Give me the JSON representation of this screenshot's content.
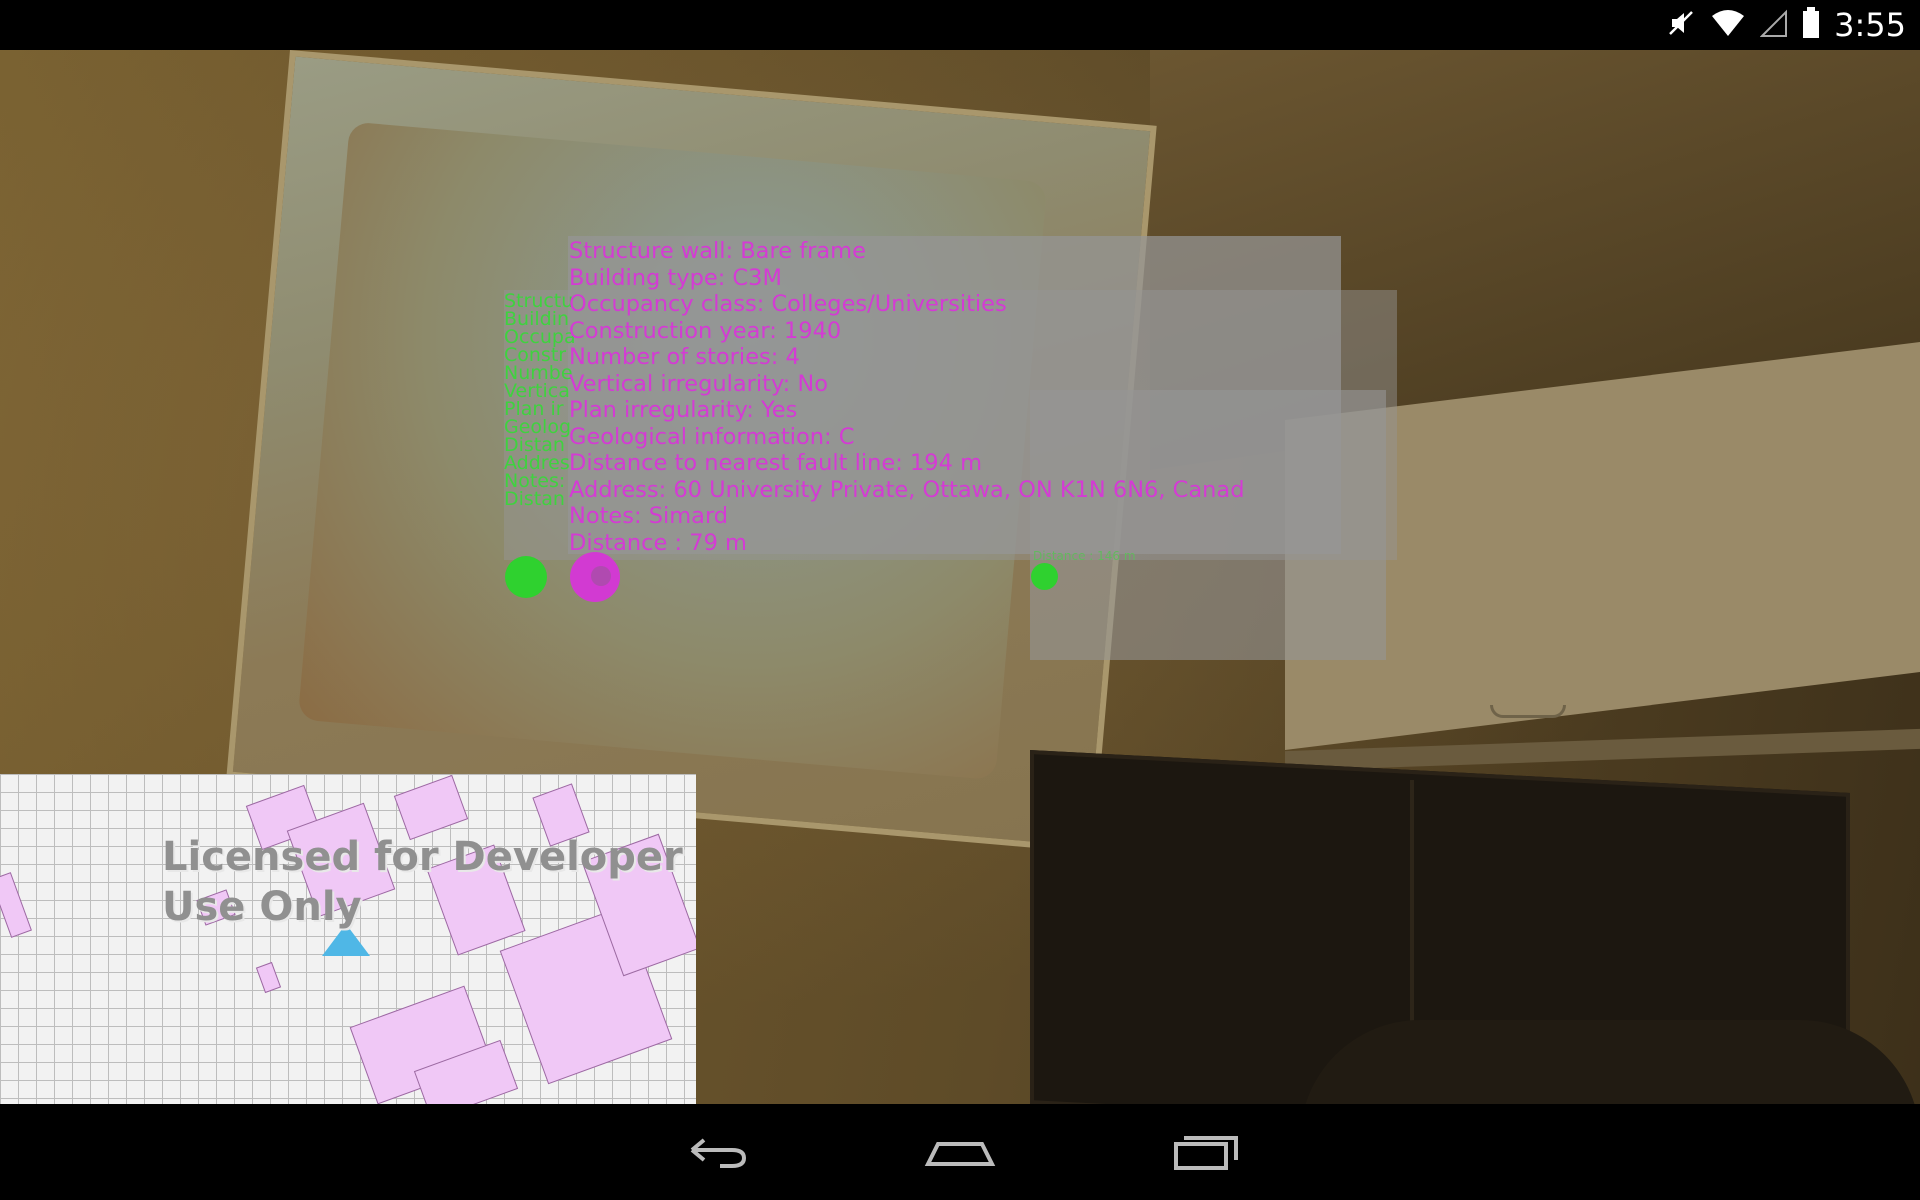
{
  "status_bar": {
    "time": "3:55",
    "icons": [
      "mute-icon",
      "wifi-icon",
      "signal-icon",
      "battery-icon"
    ]
  },
  "ar_view": {
    "building_marker_labels": {
      "structure": "Structure wall: Bare frame",
      "building_type": "Building type: C3M",
      "occupancy": "Occupancy class: Colleges/Universities",
      "construction_year": "Construction year: 1940",
      "stories": "Number of stories: 4",
      "vertical_irregularity": "Vertical irregularity: No",
      "plan_irregularity": "Plan irregularity: Yes",
      "geology": "Geological information: C",
      "fault_distance": "Distance to nearest fault line: 194 m",
      "address": "Address: 60 University Private, Ottawa, ON K1N 6N6, Canad",
      "notes": "Notes: Simard",
      "distance": "Distance : 79 m"
    },
    "left_green_labels": {
      "l1": "Structu",
      "l2": "Buildin",
      "l3": "Occupa",
      "l4": "Constr",
      "l5": "Numbe",
      "l6": "Vertica",
      "l7": "Plan ir",
      "l8": "Geolog",
      "l9": "Distan",
      "l10": "Addres",
      "l11": "Notes:",
      "l12": "Distan"
    },
    "right_marker_distance": "Distance : 146 m",
    "colors": {
      "magenta": "#d43bd4",
      "green": "#3fd23f",
      "panel": "#969696"
    }
  },
  "minimap": {
    "watermark": "Licensed for Developer\nUse Only"
  },
  "nav_bar": {
    "buttons": [
      "back-icon",
      "home-icon",
      "recent-apps-icon"
    ]
  }
}
